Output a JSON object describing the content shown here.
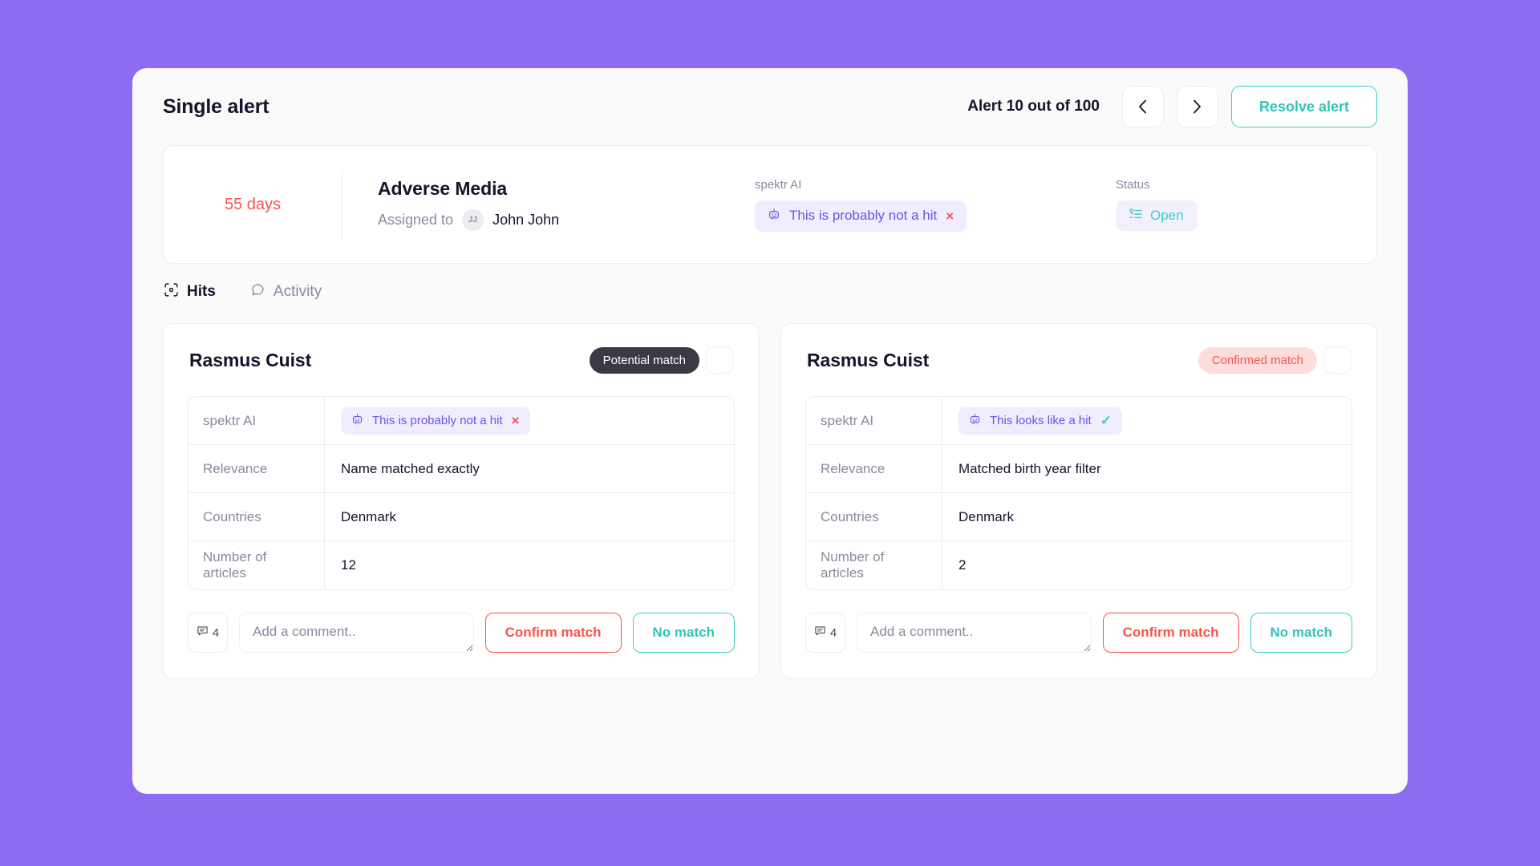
{
  "header": {
    "title": "Single alert",
    "counter": "Alert 10 out of 100",
    "prev_icon": "chevron-left-icon",
    "next_icon": "chevron-right-icon",
    "resolve_label": "Resolve alert",
    "accent_teal": "#3CCFC2"
  },
  "summary": {
    "days": "55 days",
    "days_color": "#F8544B",
    "alert_type": "Adverse Media",
    "assigned_label": "Assigned to",
    "assignee_initials": "JJ",
    "assignee_name": "John John",
    "ai_label": "spektr AI",
    "ai_verdict": "This is probably not a hit",
    "ai_mark": "×",
    "status_label": "Status",
    "status_value": "Open"
  },
  "tabs": [
    {
      "label": "Hits",
      "icon": "scan-focus-icon",
      "active": true
    },
    {
      "label": "Activity",
      "icon": "comment-bubble-icon",
      "active": false
    }
  ],
  "hits": [
    {
      "name": "Rasmus Cuist",
      "match_status": "Potential match",
      "match_kind": "potential",
      "menu_icon": "more-options-icon",
      "rows": [
        {
          "key": "spektr AI",
          "type": "ai",
          "value": "This is probably not a hit",
          "mark": "×",
          "mark_kind": "x"
        },
        {
          "key": "Relevance",
          "type": "text",
          "value": "Name matched exactly"
        },
        {
          "key": "Countries",
          "type": "text",
          "value": "Denmark"
        },
        {
          "key": "Number of articles",
          "type": "text",
          "value": "12"
        }
      ],
      "comment_count": "4",
      "comment_placeholder": "Add a comment..",
      "confirm_label": "Confirm match",
      "nomatch_label": "No match"
    },
    {
      "name": "Rasmus Cuist",
      "match_status": "Confirmed match",
      "match_kind": "confirmed",
      "menu_icon": "more-options-icon",
      "rows": [
        {
          "key": "spektr AI",
          "type": "ai",
          "value": "This looks like a hit",
          "mark": "✓",
          "mark_kind": "check"
        },
        {
          "key": "Relevance",
          "type": "text",
          "value": "Matched birth year filter"
        },
        {
          "key": "Countries",
          "type": "text",
          "value": "Denmark"
        },
        {
          "key": "Number of articles",
          "type": "text",
          "value": "2"
        }
      ],
      "comment_count": "4",
      "comment_placeholder": "Add a comment..",
      "confirm_label": "Confirm match",
      "nomatch_label": "No match"
    }
  ],
  "colors": {
    "background_purple": "#8C6CF0",
    "panel": "#FAFAFA",
    "teal": "#3CCFC2",
    "red": "#F8544B",
    "purple_text": "#6F50E8",
    "purple_pill_bg": "#F0EDFE",
    "dark_pill": "#3A3A46",
    "pink_pill": "#FDDCDC"
  }
}
